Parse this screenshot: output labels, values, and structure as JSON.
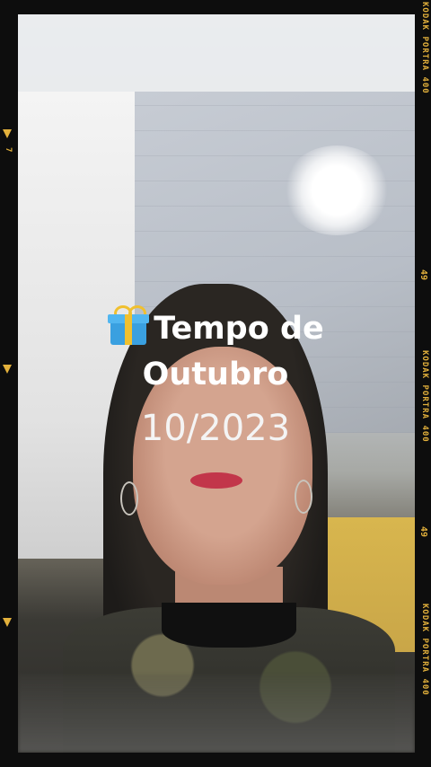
{
  "caption": {
    "line1": "Tempo de",
    "line2": "Outubro",
    "line3": "10/2023",
    "icon": "gift-icon"
  },
  "film": {
    "brand_text": "KODAK  PORTRA 400",
    "frame_number": "49",
    "marker_number": "7",
    "accent_color": "#e3b13c"
  }
}
